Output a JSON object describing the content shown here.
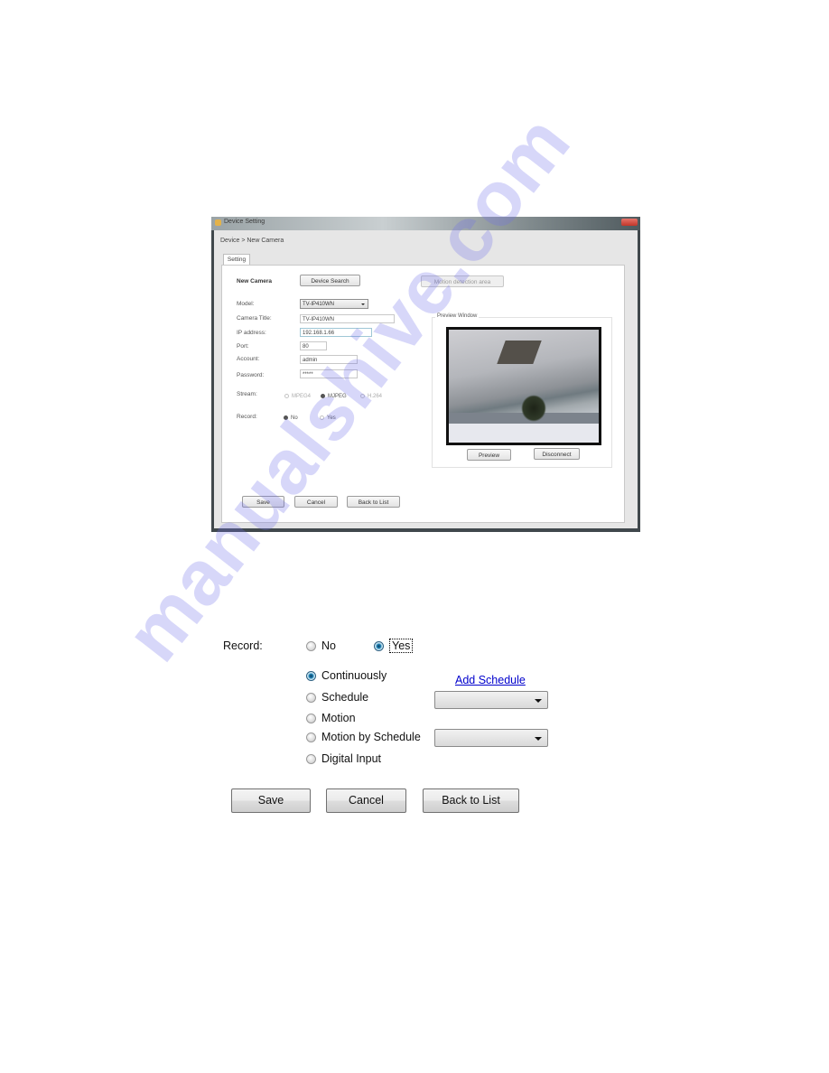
{
  "window": {
    "title": "Device Setting",
    "breadcrumb": "Device > New Camera",
    "tab": "Setting",
    "heading": "New Camera",
    "device_search_button": "Device Search",
    "motion_area_button": "Motion detection area",
    "fields": {
      "model": {
        "label": "Model:",
        "value": "TV-IP410WN"
      },
      "camera_title": {
        "label": "Camera Title:",
        "value": "TV-IP410WN"
      },
      "ip_address": {
        "label": "IP address:",
        "value": "192.168.1.66"
      },
      "port": {
        "label": "Port:",
        "value": "80"
      },
      "account": {
        "label": "Account:",
        "value": "admin"
      },
      "password": {
        "label": "Password:",
        "value": "*****"
      }
    },
    "stream": {
      "label": "Stream:",
      "options": [
        "MPEG4",
        "MJPEG",
        "H.264"
      ],
      "selected": "MJPEG"
    },
    "record": {
      "label": "Record:",
      "options": [
        "No",
        "Yes"
      ],
      "selected": "No"
    },
    "preview": {
      "group_label": "Preview Window",
      "preview_button": "Preview",
      "disconnect_button": "Disconnect"
    },
    "buttons": {
      "save": "Save",
      "cancel": "Cancel",
      "back": "Back to List"
    }
  },
  "record_detail": {
    "label": "Record:",
    "options": [
      "No",
      "Yes"
    ],
    "selected": "Yes",
    "modes": [
      "Continuously",
      "Schedule",
      "Motion",
      "Motion by Schedule",
      "Digital Input"
    ],
    "selected_mode": "Continuously",
    "add_schedule_link": "Add Schedule",
    "schedule_select_value": "",
    "motion_schedule_select_value": "",
    "buttons": {
      "save": "Save",
      "cancel": "Cancel",
      "back": "Back to List"
    }
  },
  "watermark": "manualshive.com"
}
